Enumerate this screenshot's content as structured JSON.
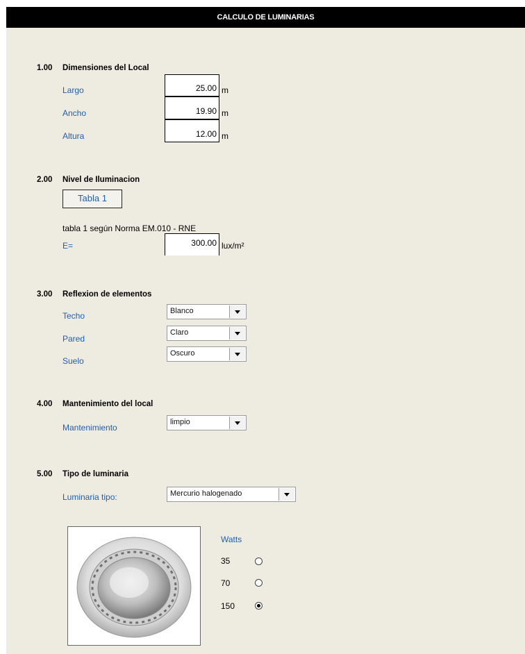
{
  "title": "CALCULO DE LUMINARIAS",
  "sections": {
    "dimensiones": {
      "number": "1.00",
      "title": "Dimensiones del Local",
      "fields": [
        {
          "label": "Largo",
          "value": "25.00",
          "unit": "m"
        },
        {
          "label": "Ancho",
          "value": "19.90",
          "unit": "m"
        },
        {
          "label": "Altura",
          "value": "12.00",
          "unit": "m"
        }
      ]
    },
    "nivel": {
      "number": "2.00",
      "title": "Nivel de Iluminacion",
      "button": "Tabla 1",
      "note": "tabla 1 según Norma EM.010 - RNE",
      "e_label": "E=",
      "e_value": "300.00",
      "e_unit": "lux/m²"
    },
    "reflexion": {
      "number": "3.00",
      "title": "Reflexion de elementos",
      "fields": [
        {
          "label": "Techo",
          "value": "Blanco"
        },
        {
          "label": "Pared",
          "value": "Claro"
        },
        {
          "label": "Suelo",
          "value": "Oscuro"
        }
      ]
    },
    "mantenimiento": {
      "number": "4.00",
      "title": "Mantenimiento del local",
      "label": "Mantenimiento",
      "value": "limpio"
    },
    "luminaria": {
      "number": "5.00",
      "title": "Tipo de luminaria",
      "label": "Luminaria tipo:",
      "value": "Mercurio halogenado",
      "watts_label": "Watts",
      "options": [
        {
          "label": "35",
          "selected": false
        },
        {
          "label": "70",
          "selected": false
        },
        {
          "label": "150",
          "selected": true
        }
      ]
    }
  },
  "colors": {
    "label_blue": "#1f5fae",
    "sheet_bg": "#eeebe1",
    "title_bg": "#000000"
  }
}
